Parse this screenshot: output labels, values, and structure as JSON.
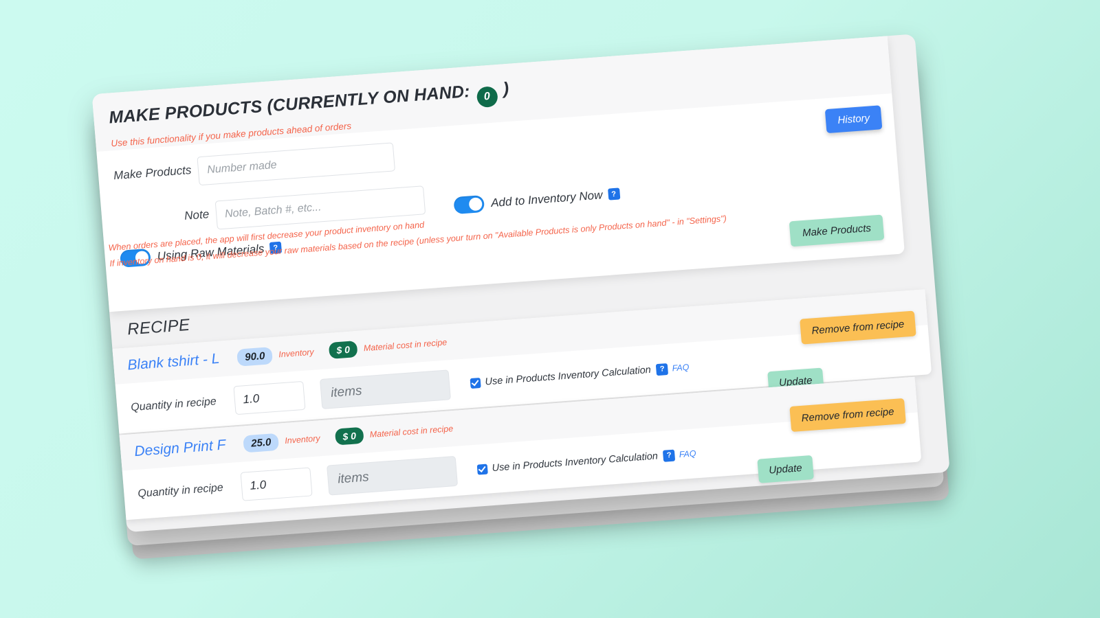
{
  "background_color": "#ccfaf0",
  "make_products_panel": {
    "title_prefix": "MAKE PRODUCTS (CURRENTLY ON HAND:",
    "on_hand_count": "0",
    "title_suffix": ")",
    "subtitle": "Use this functionality if you make products ahead of orders",
    "history_button": "History",
    "make_products_label": "Make Products",
    "make_products_placeholder": "Number made",
    "make_products_value": "",
    "note_label": "Note",
    "note_placeholder": "Note, Batch #, etc...",
    "note_value": "",
    "using_raw_materials_label": "Using Raw Materials",
    "using_raw_materials_on": true,
    "add_to_inventory_label": "Add to Inventory Now",
    "add_to_inventory_on": true,
    "help_badge": "?",
    "warning_line_1": "When orders are placed, the app will first decrease your product inventory on hand",
    "warning_line_2": "If inventory on hand is 0, it will decrease your raw materials based on the recipe (unless your turn on \"Available Products is only Products on hand\" - in \"Settings\")",
    "make_products_button": "Make Products",
    "accent_blue": "#3b82f6",
    "accent_mint": "#9fe0c6",
    "accent_red": "#f4634a",
    "badge_green": "#0f6b4a"
  },
  "recipe_section": {
    "title": "RECIPE",
    "items": [
      {
        "name": "Blank tshirt - L",
        "inventory_value": "90.0",
        "inventory_label": "Inventory",
        "cost_value": "$ 0",
        "cost_label": "Material cost in recipe",
        "quantity_label": "Quantity in recipe",
        "quantity_value": "1.0",
        "unit_value": "items",
        "use_in_calc_label": "Use in Products Inventory Calculation",
        "use_in_calc_checked": true,
        "help_badge": "?",
        "faq_link": "FAQ",
        "remove_button": "Remove from recipe",
        "update_button": "Update"
      },
      {
        "name": "Design Print F",
        "inventory_value": "25.0",
        "inventory_label": "Inventory",
        "cost_value": "$ 0",
        "cost_label": "Material cost in recipe",
        "quantity_label": "Quantity in recipe",
        "quantity_value": "1.0",
        "unit_value": "items",
        "use_in_calc_label": "Use in Products Inventory Calculation",
        "use_in_calc_checked": true,
        "help_badge": "?",
        "faq_link": "FAQ",
        "remove_button": "Remove from recipe",
        "update_button": "Update"
      }
    ],
    "badge_blue": "#bdd9fb",
    "badge_green": "#12714e",
    "remove_orange": "#fbbf54",
    "update_mint": "#9fe0c6"
  }
}
